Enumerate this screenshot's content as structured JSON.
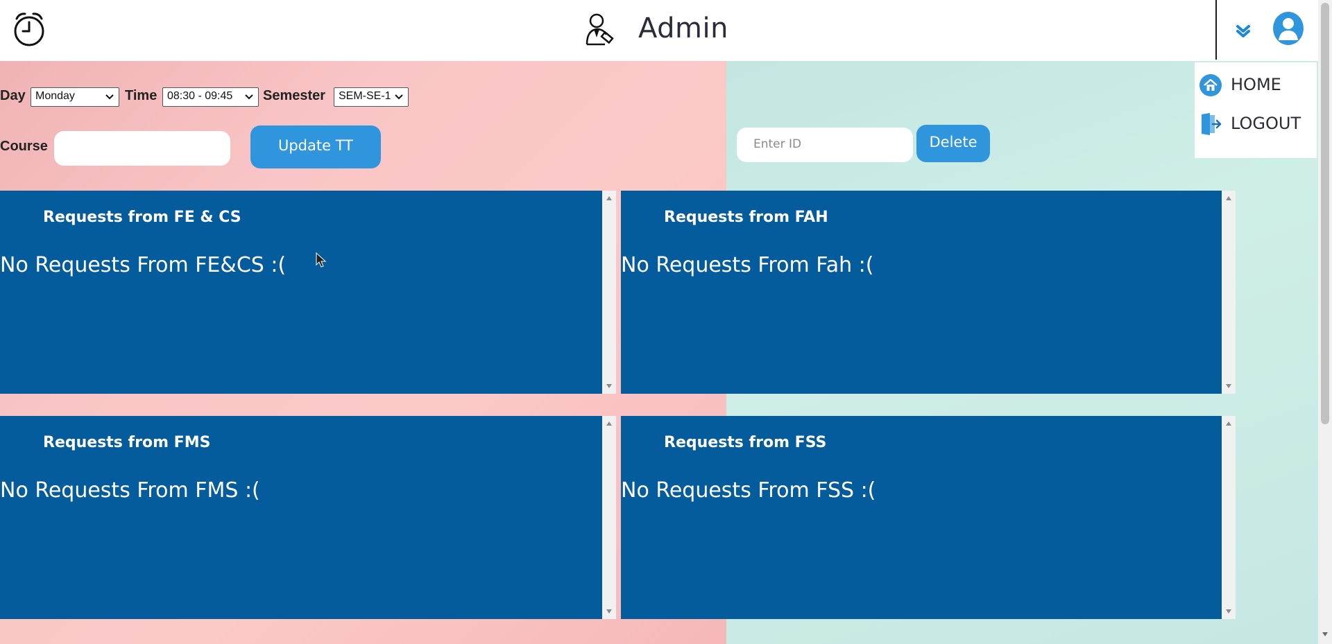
{
  "header": {
    "title": "Admin"
  },
  "icons": {
    "clock": "alarm-clock-icon",
    "admin": "admin-user-icon",
    "chevron": "double-chevron-down-icon",
    "avatar": "user-avatar-icon",
    "home": "home-icon",
    "logout": "logout-icon"
  },
  "colors": {
    "panel_bg": "#055c9d",
    "button_bg": "#2f95dc",
    "left_bg": "#f9c5c6",
    "right_bg": "#c6e8e2"
  },
  "menu": {
    "home_label": "HOME",
    "logout_label": "LOGOUT"
  },
  "form": {
    "day_label": "Day",
    "day_value": "Monday",
    "time_label": "Time",
    "time_value": "08:30 - 09:45",
    "semester_label": "Semester",
    "semester_value": "SEM-SE-1",
    "course_label": "Course",
    "course_value": "",
    "update_button": "Update TT",
    "id_placeholder": "Enter ID",
    "delete_button": "Delete"
  },
  "panels": [
    {
      "title": "Requests from FE & CS",
      "message": "No Requests From FE&CS :("
    },
    {
      "title": "Requests from FAH",
      "message": "No Requests From Fah :("
    },
    {
      "title": "Requests from FMS",
      "message": "No Requests From FMS :("
    },
    {
      "title": "Requests from FSS",
      "message": "No Requests From FSS :("
    }
  ]
}
